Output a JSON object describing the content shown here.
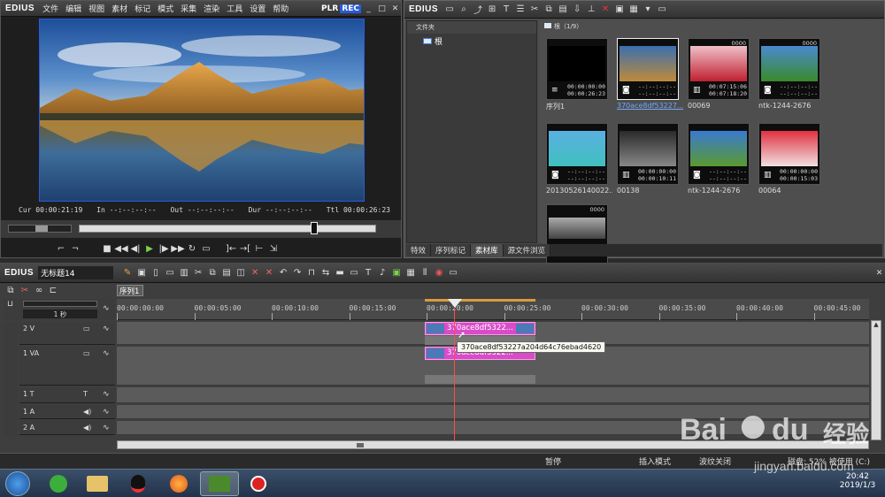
{
  "player": {
    "logo": "EDIUS",
    "menu": [
      "文件",
      "编辑",
      "视图",
      "素材",
      "标记",
      "模式",
      "采集",
      "渲染",
      "工具",
      "设置",
      "帮助"
    ],
    "plr": "PLR",
    "rec": "REC",
    "timecodes": {
      "cur_label": "Cur",
      "cur": "00:00:21:19",
      "in_label": "In",
      "in": "--:--:--:--",
      "out_label": "Out",
      "out": "--:--:--:--",
      "dur_label": "Dur",
      "dur": "--:--:--:--",
      "ttl_label": "Ttl",
      "ttl": "00:00:26:23"
    }
  },
  "bin": {
    "logo": "EDIUS",
    "folder_header": "文件夹",
    "root_label": "根",
    "path_label": "根（1/9）",
    "clips": [
      {
        "name": "序列1",
        "tc1": "00:00:00:00",
        "tc2": "00:00:26:23",
        "icon": "sequence",
        "badge": ""
      },
      {
        "name": "370ace8df53227...",
        "tc1": "--:--:--:--",
        "tc2": "--:--:--:--",
        "icon": "camera",
        "badge": "",
        "selected": true
      },
      {
        "name": "00069",
        "tc1": "00:07:15:06",
        "tc2": "00:07:18:20",
        "icon": "film",
        "badge": "0000"
      },
      {
        "name": "ntk-1244-2676",
        "tc1": "--:--:--:--",
        "tc2": "--:--:--:--",
        "icon": "camera",
        "badge": "0000"
      },
      {
        "name": "20130526140022...",
        "tc1": "--:--:--:--",
        "tc2": "--:--:--:--",
        "icon": "camera",
        "badge": ""
      },
      {
        "name": "00138",
        "tc1": "00:00:00:00",
        "tc2": "00:00:10:11",
        "icon": "film",
        "badge": ""
      },
      {
        "name": "ntk-1244-2676",
        "tc1": "--:--:--:--",
        "tc2": "--:--:--:--",
        "icon": "camera",
        "badge": ""
      },
      {
        "name": "00064",
        "tc1": "00:00:00:00",
        "tc2": "00:00:15:03",
        "icon": "film",
        "badge": ""
      },
      {
        "name": "",
        "tc1": "",
        "tc2": "",
        "icon": "",
        "badge": "0000"
      }
    ],
    "tabs": [
      "特效",
      "序列标记",
      "素材库",
      "源文件浏览"
    ]
  },
  "timeline": {
    "logo": "EDIUS",
    "project": "无标题14",
    "sequence_tab": "序列1",
    "scale": "1 秒",
    "ruler": [
      "00:00:00:00",
      "00:00:05:00",
      "00:00:10:00",
      "00:00:15:00",
      "00:00:20:00",
      "00:00:25:00",
      "00:00:30:00",
      "00:00:35:00",
      "00:00:40:00",
      "00:00:45:00"
    ],
    "tracks": [
      {
        "name": "2 V"
      },
      {
        "name": "1 VA"
      },
      {
        "name": "1 T"
      },
      {
        "name": "1 A"
      },
      {
        "name": "2 A"
      }
    ],
    "clip_label": "370ace8df5322...",
    "clip_label_audio": "370ace8df5322...",
    "tooltip": "370ace8df53227a204d64c76ebad4620"
  },
  "status": {
    "state": "暂停",
    "mode": "插入模式",
    "ripple": "波纹关闭",
    "disk": "磁盘: 52% 被使用 (C:)"
  },
  "taskbar": {
    "time": "20:42",
    "date": "2019/1/3"
  },
  "watermark": {
    "brand": "Bai",
    "cn": "经验",
    "url": "jingyan.baidu.com"
  }
}
